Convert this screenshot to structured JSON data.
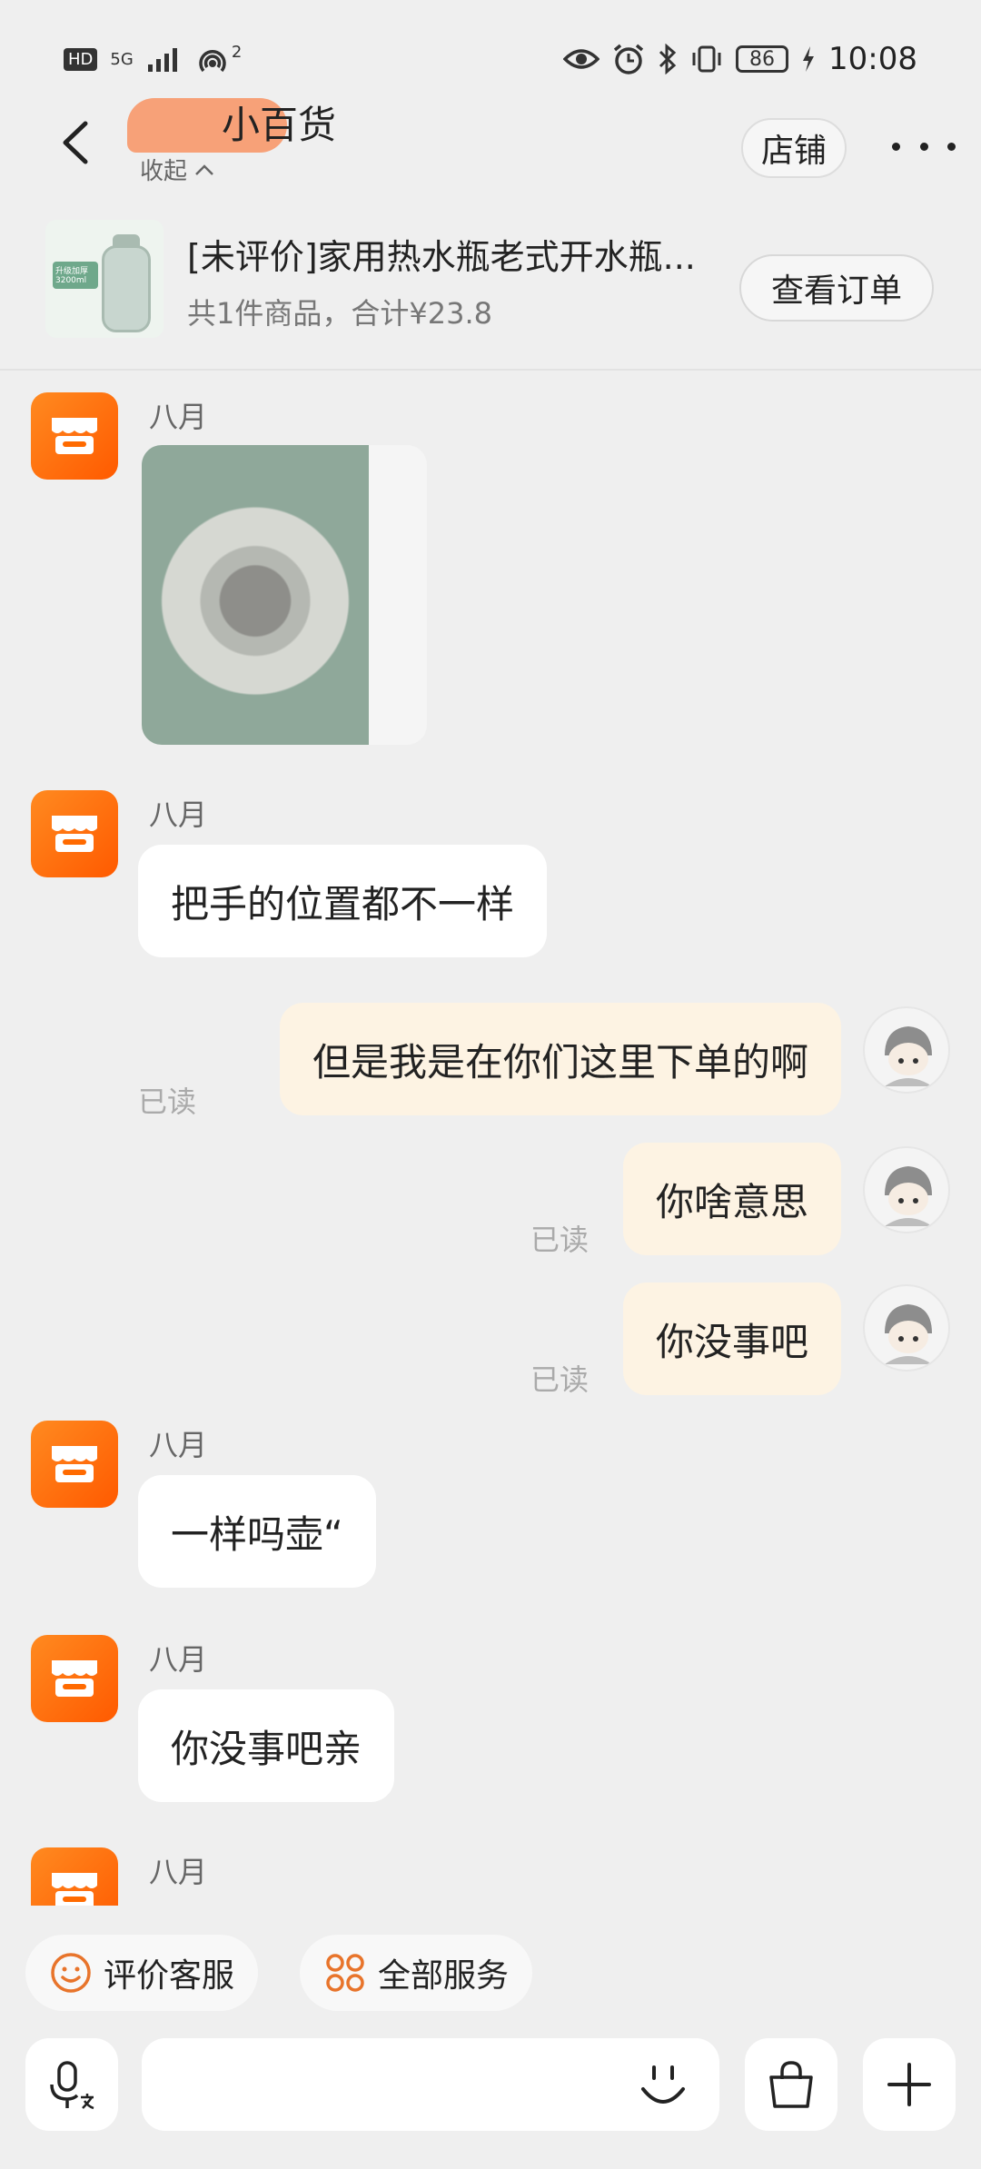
{
  "status_bar": {
    "hd": "HD",
    "network": "5G",
    "hotspot_count": "2",
    "battery": "86",
    "time": "10:08"
  },
  "nav": {
    "shop_title": "小百货",
    "collapse_label": "收起",
    "store_button": "店铺"
  },
  "order": {
    "title": "[未评价]家用热水瓶老式开水瓶...",
    "summary": "共1件商品，合计¥23.8",
    "thumb_tag": "升级加厚 3200ml",
    "view_button": "查看订单"
  },
  "messages": {
    "m1_sender": "八月",
    "m2_sender": "八月",
    "m2_text": "把手的位置都不一样",
    "m3_text": "但是我是在你们这里下单的啊",
    "m3_status": "已读",
    "m4_text": "你啥意思",
    "m4_status": "已读",
    "m5_text": "你没事吧",
    "m5_status": "已读",
    "m6_sender": "八月",
    "m6_text": "一样吗壶“",
    "m7_sender": "八月",
    "m7_text": "你没事吧亲",
    "m8_sender": "八月"
  },
  "services": {
    "rate_label": "评价客服",
    "all_label": "全部服务"
  },
  "input": {
    "placeholder": ""
  },
  "colors": {
    "accent": "#ff6a00",
    "bubble_out": "#fdf3e3",
    "bubble_in": "#ffffff",
    "background": "#efefef"
  },
  "icons": [
    "back-arrow-icon",
    "chevron-up-icon",
    "more-icon",
    "shop-awning-icon",
    "smile-face-icon",
    "grid-services-icon",
    "voice-input-icon",
    "emoji-icon",
    "shopping-bag-icon",
    "plus-icon"
  ]
}
